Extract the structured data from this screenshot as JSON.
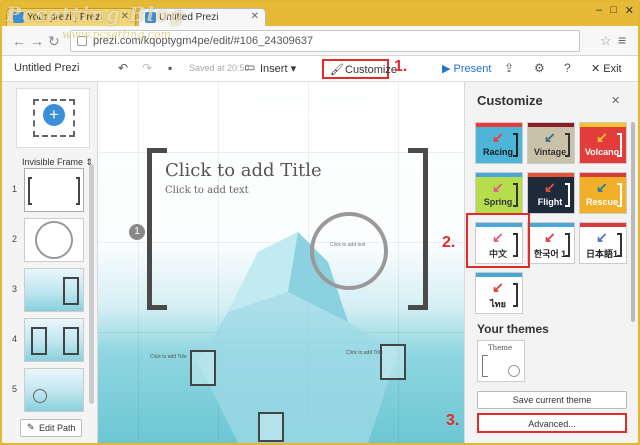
{
  "browser": {
    "tabs": [
      {
        "title": "Your prezi | Prezi",
        "active": false
      },
      {
        "title": "Untitled Prezi",
        "active": true
      }
    ],
    "url": "prezi.com/kqoptygm4pe/edit/#106_24309637",
    "window_controls": [
      "–",
      "□",
      "✕"
    ]
  },
  "watermark": {
    "main": "Pcsetting Blog",
    "sub": "www.pcsetting.com"
  },
  "toolbar": {
    "doc_title": "Untitled Prezi",
    "saved_text": "Saved at 20:50",
    "insert_label": "Insert",
    "customize_label": "Customize",
    "present_label": "Present",
    "exit_label": "Exit"
  },
  "steps": {
    "one": "1.",
    "two": "2.",
    "three": "3."
  },
  "left_sidebar": {
    "frame_type": "Invisible Frame",
    "thumbnails": [
      "1",
      "2",
      "3",
      "4",
      "5"
    ],
    "edit_path_label": "Edit Path"
  },
  "canvas": {
    "title": "Click to add Title",
    "text": "Click to add text",
    "step_number": "1",
    "circle_text": "Click to add text",
    "mini_title": "Click to add Title"
  },
  "customize_panel": {
    "heading": "Customize",
    "themes": [
      {
        "name": "Racing",
        "bg": "#4db6d8",
        "text": "#1a1a1a",
        "arrow": "#e93b3b",
        "stripe": "#e93b3b",
        "bracket": "#222222"
      },
      {
        "name": "Vintage",
        "bg": "#c9c2a9",
        "text": "#333333",
        "arrow": "#3f6a8a",
        "stripe": "#8b1d2a",
        "bracket": "#333333"
      },
      {
        "name": "Volcano",
        "bg": "#e23d3a",
        "text": "#ffffff",
        "arrow": "#f3c52d",
        "stripe": "#f3c52d",
        "bracket": "#ffffff"
      },
      {
        "name": "Spring",
        "bg": "#b5dd4e",
        "text": "#333333",
        "arrow": "#e9548e",
        "stripe": "#4aa8d8",
        "bracket": "#333333"
      },
      {
        "name": "Flight",
        "bg": "#1f2a3a",
        "text": "#ffffff",
        "arrow": "#e6523b",
        "stripe": "#e6523b",
        "bracket": "#ffffff"
      },
      {
        "name": "Rescue",
        "bg": "#f2b02a",
        "text": "#ffffff",
        "arrow": "#1e7fa0",
        "stripe": "#d83c3c",
        "bracket": "#ffffff"
      },
      {
        "name": "中文",
        "bg": "#ffffff",
        "text": "#333333",
        "arrow": "#e9548e",
        "stripe": "#4aa8d8",
        "bracket": "#333333"
      },
      {
        "name": "한국어 1",
        "bg": "#ffffff",
        "text": "#222222",
        "arrow": "#d83c3c",
        "stripe": "#4aa8d8",
        "bracket": "#333333"
      },
      {
        "name": "日本語1",
        "bg": "#ffffff",
        "text": "#222222",
        "arrow": "#4a74c9",
        "stripe": "#d83c3c",
        "bracket": "#333333"
      },
      {
        "name": "ไทย",
        "bg": "#ffffff",
        "text": "#222222",
        "arrow": "#d83c3c",
        "stripe": "#4aa8d8",
        "bracket": "#333333"
      }
    ],
    "your_themes_label": "Your themes",
    "my_theme_title": "Theme",
    "save_theme_label": "Save current theme",
    "advanced_label": "Advanced..."
  },
  "colors": {
    "accent_red": "#e52a2a",
    "present_blue": "#1f73d1"
  }
}
